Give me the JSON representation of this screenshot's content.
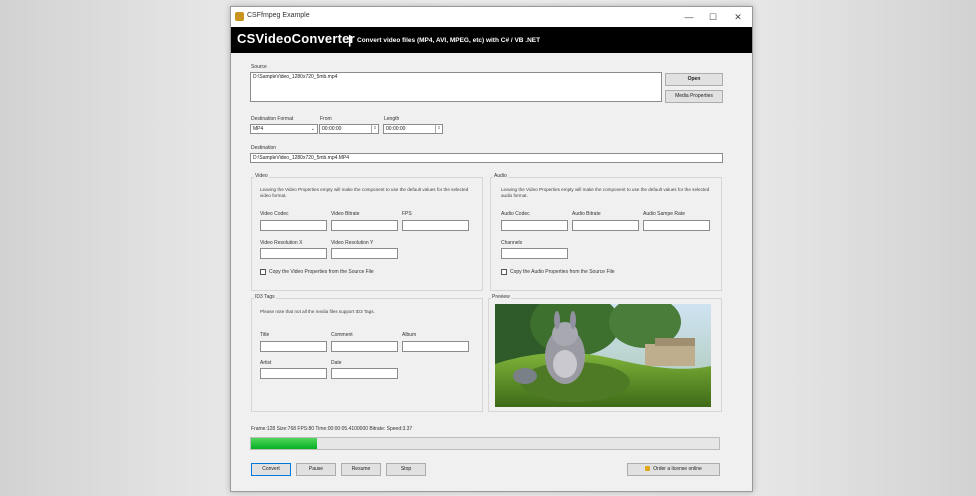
{
  "window": {
    "title": "CSFfmpeg Example",
    "buttons": {
      "minimize": "—",
      "maximize": "☐",
      "close": "✕"
    }
  },
  "banner": {
    "title": "CSVideoConverter",
    "separator": "|",
    "subtitle": "Convert video files (MP4, AVI, MPEG, etc) with C# / VB .NET"
  },
  "source": {
    "label": "Source",
    "value": "D:\\SampleVideo_1280x720_5mb.mp4",
    "open_label": "Open",
    "media_properties_label": "Media Properties"
  },
  "dest_format": {
    "label": "Destination Format",
    "value": "MP4"
  },
  "from": {
    "label": "From",
    "value": "00:00:00"
  },
  "length": {
    "label": "Length",
    "value": "00:00:00"
  },
  "destination": {
    "label": "Destination",
    "value": "D:\\SampleVideo_1280x720_5mb.mp4.MP4"
  },
  "video": {
    "title": "Video",
    "note": "Leaving the Video Properties empty will make the component to use the default values for the selected video format.",
    "codec_label": "Video Codec",
    "bitrate_label": "Video Bitrate",
    "fps_label": "FPS",
    "res_x_label": "Video Resolution X",
    "res_y_label": "Video Resolution Y",
    "copy_label": "Copy the Video Properties from the Source File",
    "copy_checked": false
  },
  "audio": {
    "title": "Audio",
    "note": "Leaving the Video Properties empty will make the component to use the default values for the selected audio format.",
    "codec_label": "Audio Codec",
    "bitrate_label": "Audio Bitrate",
    "sample_rate_label": "Audio Sampe Rate",
    "channels_label": "Channels",
    "copy_label": "Copy the Audio Properties from the Source File",
    "copy_checked": false
  },
  "id3": {
    "title": "ID3 Tags",
    "note": "Please note that not all the media files support ID3 Tags.",
    "title_label": "Title",
    "comment_label": "Comment",
    "album_label": "Album",
    "artist_label": "Artist",
    "date_label": "Date"
  },
  "preview": {
    "title": "Preview"
  },
  "status": {
    "text": "Frame:128 Size:768 FPS:80 Time:00:00:05.4100000 Bitrate: Speed:3.37",
    "progress_fraction": 0.14
  },
  "buttons": {
    "convert": "Convert",
    "pause": "Pause",
    "resume": "Resume",
    "stop": "Stop",
    "license": "Order a license online"
  },
  "colors": {
    "banner": "#000000",
    "progress": "#06b025"
  }
}
